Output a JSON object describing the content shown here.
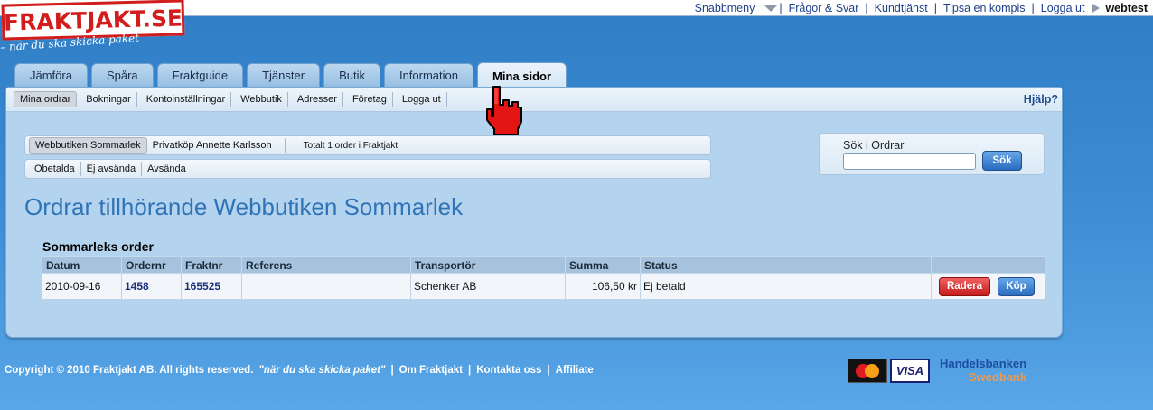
{
  "brand": {
    "logo": "FRAKTJAKT.SE",
    "slogan": "– när du ska skicka paket"
  },
  "topbar": {
    "links": [
      "Snabbmeny",
      "Frågor & Svar",
      "Kundtjänst",
      "Tipsa en kompis",
      "Logga ut"
    ],
    "username": "webtest"
  },
  "tabs": [
    "Jämföra",
    "Spåra",
    "Fraktguide",
    "Tjänster",
    "Butik",
    "Information",
    "Mina sidor"
  ],
  "subnav": {
    "items": [
      "Mina ordrar",
      "Bokningar",
      "Kontoinställningar",
      "Webbutik",
      "Adresser",
      "Företag",
      "Logga ut"
    ],
    "help": "Hjälp?"
  },
  "filters": {
    "row1": [
      "Webbutiken Sommarlek",
      "Privatköp Annette Karlsson"
    ],
    "total": "Totalt 1 order i Fraktjakt",
    "row2": [
      "Obetalda",
      "Ej avsända",
      "Avsända"
    ]
  },
  "search": {
    "label": "Sök i Ordrar",
    "value": "",
    "button": "Sök"
  },
  "page": {
    "heading": "Ordrar tillhörande Webbutiken Sommarlek",
    "table_title": "Sommarleks order"
  },
  "orders": {
    "columns": [
      "Datum",
      "Ordernr",
      "Fraktnr",
      "Referens",
      "Transportör",
      "Summa",
      "Status",
      ""
    ],
    "rows": [
      {
        "datum": "2010-09-16",
        "ordernr": "1458",
        "fraktnr": "165525",
        "referens": "",
        "transportor": "Schenker AB",
        "summa": "106,50 kr",
        "status": "Ej betald",
        "delete_label": "Radera",
        "buy_label": "Köp"
      }
    ]
  },
  "footer": {
    "copyright": "Copyright © 2010 Fraktjakt AB.  All rights reserved.",
    "slogan": "\"när du ska skicka paket\"",
    "links": [
      "Om Fraktjakt",
      "Kontakta oss",
      "Affiliate"
    ],
    "cards": [
      "MasterCard",
      "VISA"
    ],
    "banks": [
      "Handelsbanken",
      "Swedbank"
    ]
  },
  "colors": {
    "brand_red": "#d21d1d",
    "heading_blue": "#2f74b6",
    "button_blue": "#2a6bbf",
    "button_red": "#c61c1c"
  }
}
